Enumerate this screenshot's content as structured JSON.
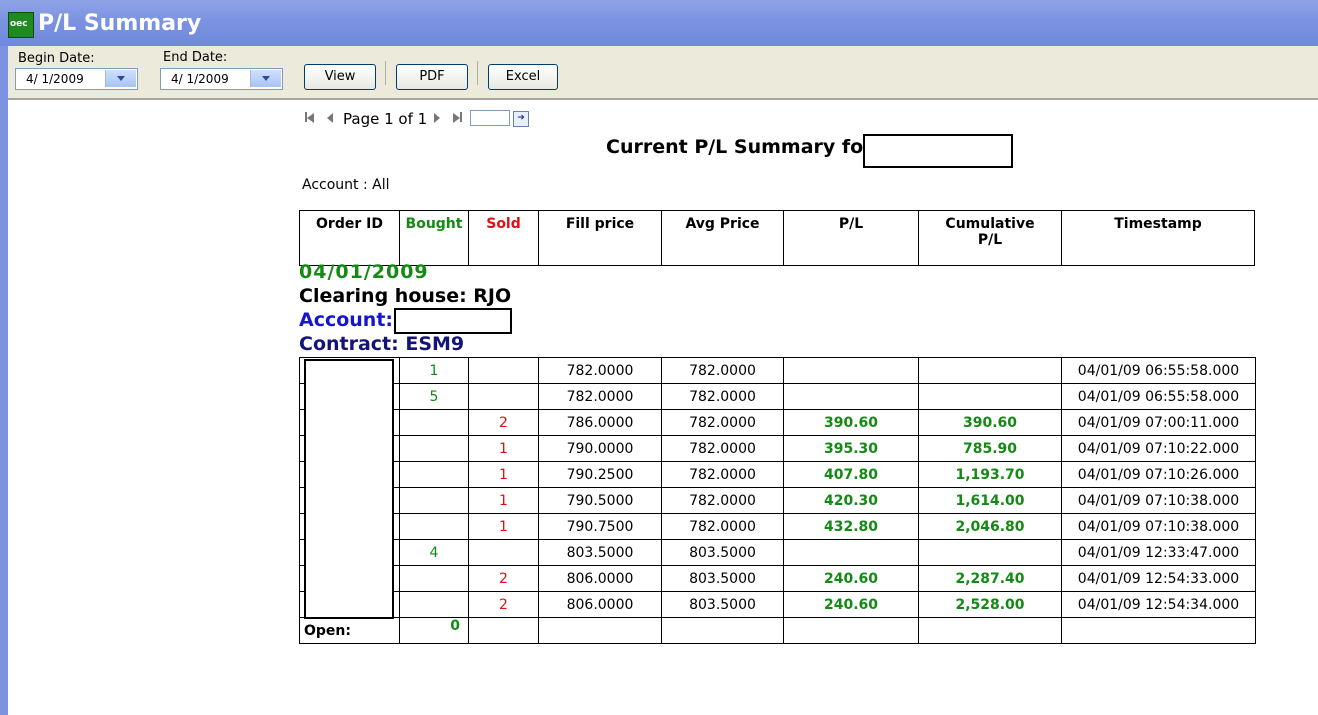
{
  "window": {
    "title": "P/L Summary",
    "icon_text": "oec"
  },
  "toolbar": {
    "begin_label": "Begin Date:",
    "begin_value": "4/ 1/2009",
    "end_label": "End Date:",
    "end_value": "4/ 1/2009",
    "view_label": "View",
    "pdf_label": "PDF",
    "excel_label": "Excel"
  },
  "pager": {
    "text": "Page 1 of 1"
  },
  "report": {
    "title": "Current P/L Summary for",
    "account_filter": "Account : All",
    "columns": [
      "Order ID",
      "Bought",
      "Sold",
      "Fill price",
      "Avg Price",
      "P/L",
      "Cumulative P/L",
      "Timestamp"
    ],
    "date": "04/01/2009",
    "clearing_house": "Clearing house: RJO",
    "account_label": "Account:",
    "contract": "Contract: ESM9",
    "rows": [
      {
        "bought": "1",
        "sold": "",
        "fill": "782.0000",
        "avg": "782.0000",
        "pl": "",
        "cum": "",
        "ts": "04/01/09 06:55:58.000"
      },
      {
        "bought": "5",
        "sold": "",
        "fill": "782.0000",
        "avg": "782.0000",
        "pl": "",
        "cum": "",
        "ts": "04/01/09 06:55:58.000"
      },
      {
        "bought": "",
        "sold": "2",
        "fill": "786.0000",
        "avg": "782.0000",
        "pl": "390.60",
        "cum": "390.60",
        "ts": "04/01/09 07:00:11.000"
      },
      {
        "bought": "",
        "sold": "1",
        "fill": "790.0000",
        "avg": "782.0000",
        "pl": "395.30",
        "cum": "785.90",
        "ts": "04/01/09 07:10:22.000"
      },
      {
        "bought": "",
        "sold": "1",
        "fill": "790.2500",
        "avg": "782.0000",
        "pl": "407.80",
        "cum": "1,193.70",
        "ts": "04/01/09 07:10:26.000"
      },
      {
        "bought": "",
        "sold": "1",
        "fill": "790.5000",
        "avg": "782.0000",
        "pl": "420.30",
        "cum": "1,614.00",
        "ts": "04/01/09 07:10:38.000"
      },
      {
        "bought": "",
        "sold": "1",
        "fill": "790.7500",
        "avg": "782.0000",
        "pl": "432.80",
        "cum": "2,046.80",
        "ts": "04/01/09 07:10:38.000"
      },
      {
        "bought": "4",
        "sold": "",
        "fill": "803.5000",
        "avg": "803.5000",
        "pl": "",
        "cum": "",
        "ts": "04/01/09 12:33:47.000"
      },
      {
        "bought": "",
        "sold": "2",
        "fill": "806.0000",
        "avg": "803.5000",
        "pl": "240.60",
        "cum": "2,287.40",
        "ts": "04/01/09 12:54:33.000"
      },
      {
        "bought": "",
        "sold": "2",
        "fill": "806.0000",
        "avg": "803.5000",
        "pl": "240.60",
        "cum": "2,528.00",
        "ts": "04/01/09 12:54:34.000"
      }
    ],
    "open_label": "Open:",
    "open_value": "0"
  },
  "colors": {
    "titlebar": "#7b93e0",
    "green": "#138a13",
    "red": "#e01010",
    "blue": "#1414d2",
    "navy": "#141478"
  }
}
